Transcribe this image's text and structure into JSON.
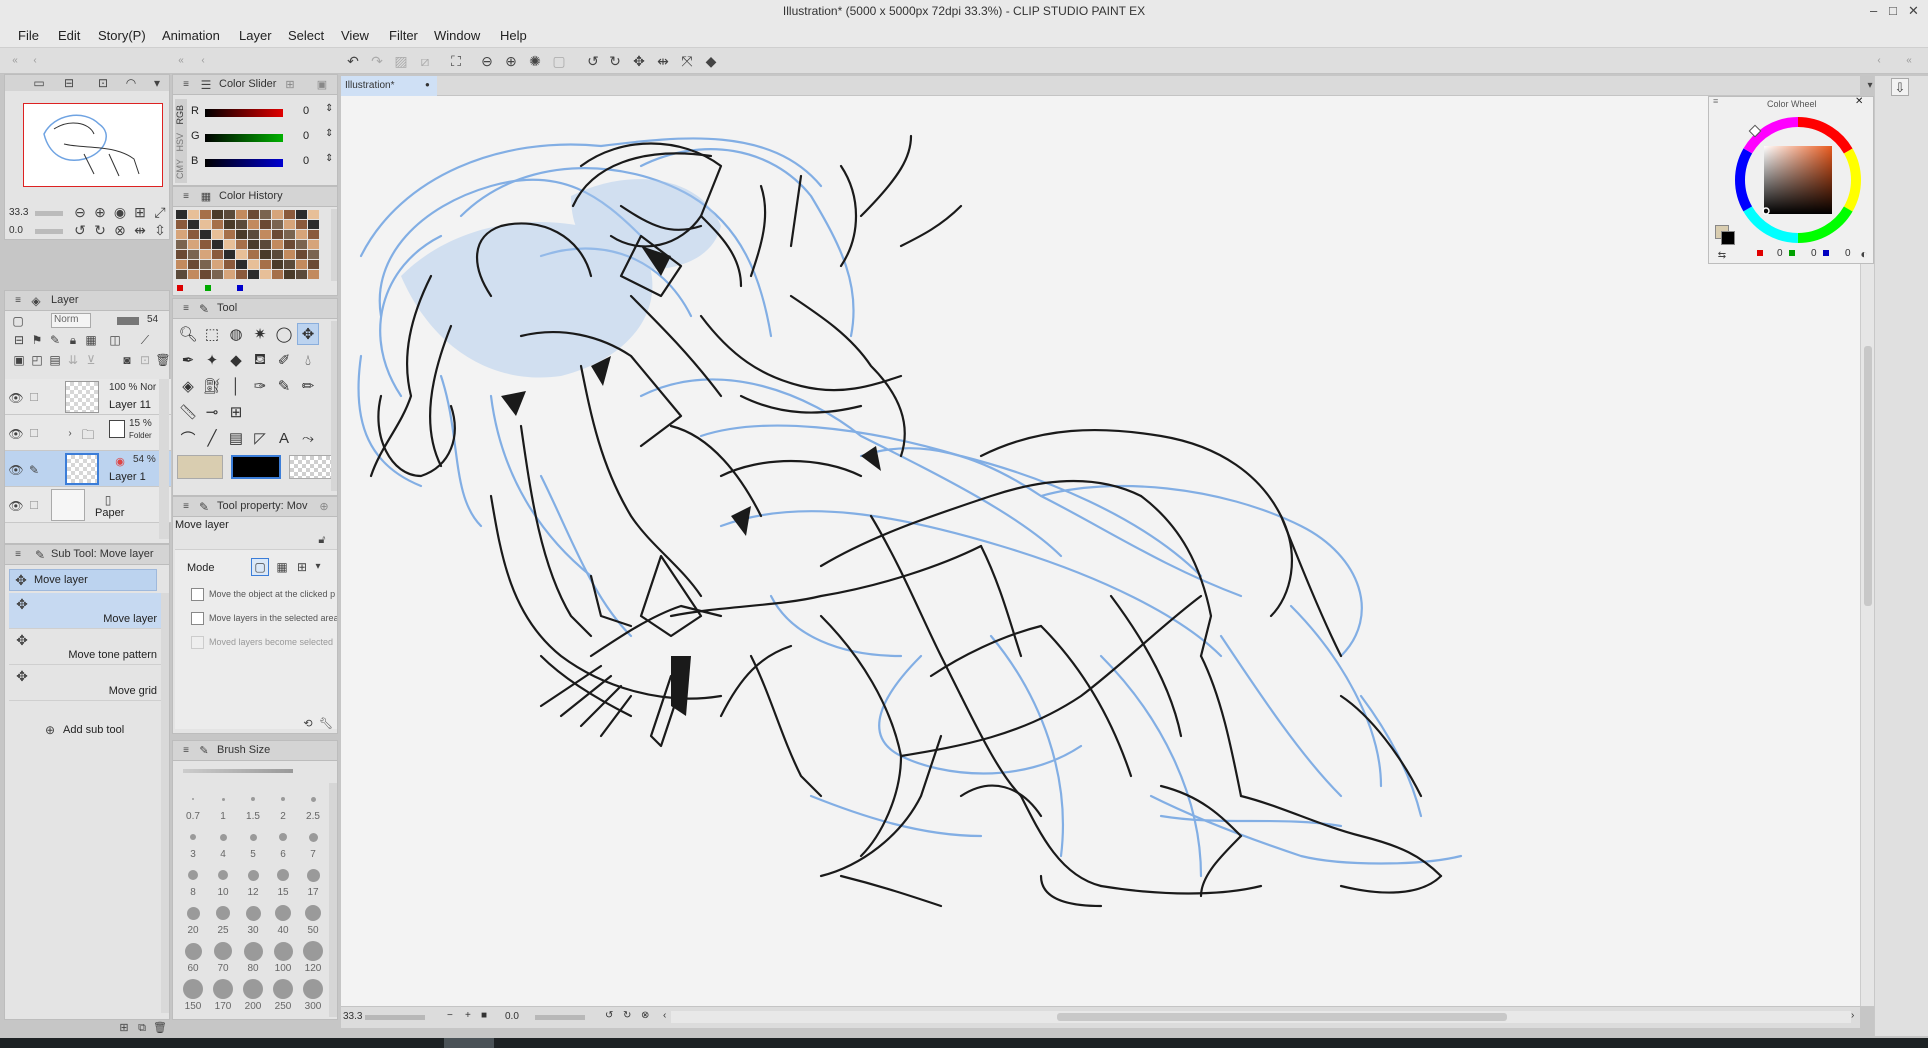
{
  "window": {
    "title": "Illustration* (5000 x 5000px 72dpi 33.3%)  - CLIP STUDIO PAINT EX",
    "controls": [
      "–",
      "□",
      "✕"
    ]
  },
  "menu": [
    "File",
    "Edit",
    "Story(P)",
    "Animation",
    "Layer",
    "Select",
    "View",
    "Filter",
    "Window",
    "Help"
  ],
  "document_tab": {
    "label": "Illustration*",
    "dot": "●"
  },
  "navigator": {
    "zoom": "33.3",
    "angle": "0.0"
  },
  "color_slider": {
    "title": "Color Slider",
    "modes": [
      "RGB",
      "HSV",
      "CMY"
    ],
    "channels": [
      {
        "label": "R",
        "value": "0",
        "color": "#e00000"
      },
      {
        "label": "G",
        "value": "0",
        "color": "#00a000"
      },
      {
        "label": "B",
        "value": "0",
        "color": "#0000c0"
      }
    ]
  },
  "color_history": {
    "title": "Color History"
  },
  "color_wheel": {
    "title": "Color Wheel",
    "values": [
      "0",
      "0",
      "0"
    ]
  },
  "layer_panel": {
    "title": "Layer",
    "blend_mode": "Norm",
    "opacity": "54",
    "layers": [
      {
        "opacity": "100 % Nor",
        "name": "Layer 11"
      },
      {
        "opacity": "15 %",
        "sub": "Folder",
        "name": ""
      },
      {
        "opacity": "54 %",
        "name": "Layer 1"
      },
      {
        "opacity": "",
        "name": "Paper"
      }
    ]
  },
  "tool_panel": {
    "title": "Tool"
  },
  "subtool_panel": {
    "title": "Sub Tool: Move layer",
    "active_header": "Move layer",
    "items": [
      "Move layer",
      "Move tone pattern",
      "Move grid"
    ],
    "add_label": "Add sub tool"
  },
  "tool_property": {
    "title": "Tool property: Mov",
    "tool_name": "Move layer",
    "mode_label": "Mode",
    "options": [
      "Move the object at the clicked p",
      "Move layers in the selected area",
      "Moved layers become selected"
    ]
  },
  "brush_size": {
    "title": "Brush Size",
    "sizes": [
      "0.7",
      "1",
      "1.5",
      "2",
      "2.5",
      "3",
      "4",
      "5",
      "6",
      "7",
      "8",
      "10",
      "12",
      "15",
      "17",
      "20",
      "25",
      "30",
      "40",
      "50",
      "60",
      "70",
      "80",
      "100",
      "120",
      "150",
      "170",
      "200",
      "250",
      "300"
    ]
  },
  "status": {
    "zoom": "33.3",
    "angle": "0.0"
  },
  "colors": {
    "main": "#d9cdb0",
    "sub": "#000000",
    "sketch_blue": "#6fa3e2",
    "line_black": "#1a1a1a",
    "accent_red": "#e00000"
  }
}
